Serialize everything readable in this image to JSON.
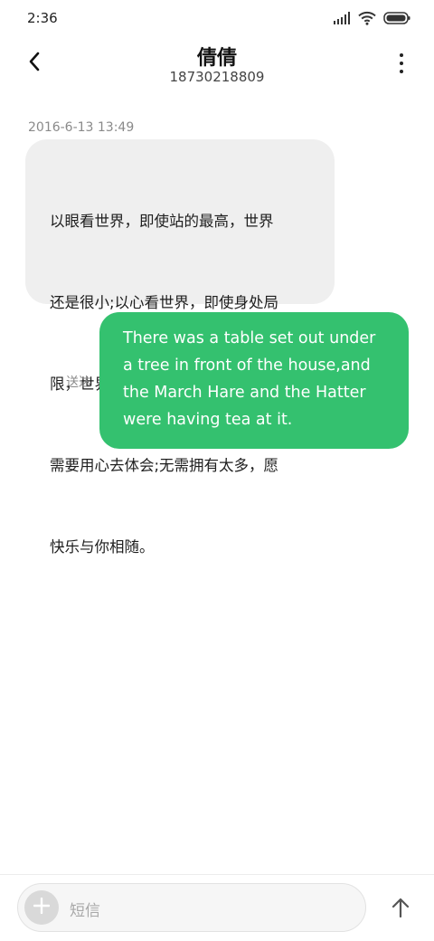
{
  "status_bar": {
    "time": "2:36",
    "icons": [
      "signal-icon",
      "wifi-icon",
      "battery-icon"
    ]
  },
  "header": {
    "contact_name": "倩倩",
    "contact_number": "18730218809",
    "back_icon": "back-arrow-icon",
    "more_icon": "more-vertical-icon"
  },
  "conversation": {
    "timestamp": "2016-6-13 13:49",
    "messages": [
      {
        "direction": "incoming",
        "lines": [
          "以眼看世界，即使站的最高，世界",
          "还是很小;以心看世界，即使身处局",
          "限，世界依然很大。生活远不完美，",
          "需要用心去体会;无需拥有太多，愿",
          "快乐与你相随。"
        ]
      },
      {
        "direction": "outgoing",
        "status": "送达",
        "lines": [
          "There was a table set out under",
          "a tree in front of the house,and",
          "the March Hare and the Hatter",
          "were having tea at it."
        ]
      }
    ]
  },
  "composer": {
    "placeholder": "短信",
    "add_icon": "plus-icon",
    "send_icon": "send-arrow-icon"
  },
  "colors": {
    "incoming_bubble": "#efefef",
    "outgoing_bubble": "#34c16f",
    "meta_text": "#8a8a8a"
  }
}
